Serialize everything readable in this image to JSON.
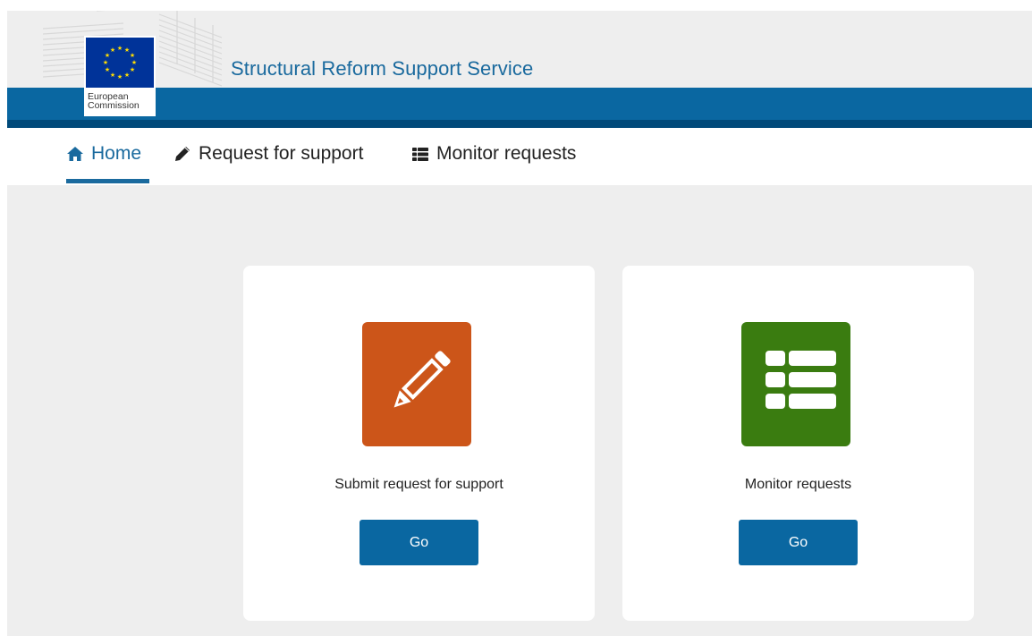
{
  "header": {
    "title": "Structural Reform Support Service",
    "logo_text_line1": "European",
    "logo_text_line2": "Commission",
    "colors": {
      "band": "#0a67a1",
      "band_dark": "#004a7a",
      "title": "#1a6a9e",
      "flag": "#003399",
      "star": "#ffdd00"
    }
  },
  "nav": {
    "items": [
      {
        "label": "Home",
        "icon": "home-icon",
        "active": true
      },
      {
        "label": "Request for support",
        "icon": "pencil-icon",
        "active": false
      },
      {
        "label": "Monitor requests",
        "icon": "list-icon",
        "active": false
      }
    ]
  },
  "cards": [
    {
      "label": "Submit request for support",
      "button": "Go",
      "icon": "pencil-icon",
      "color": "#cc5519"
    },
    {
      "label": "Monitor requests",
      "button": "Go",
      "icon": "list-icon",
      "color": "#3a7c10"
    }
  ]
}
